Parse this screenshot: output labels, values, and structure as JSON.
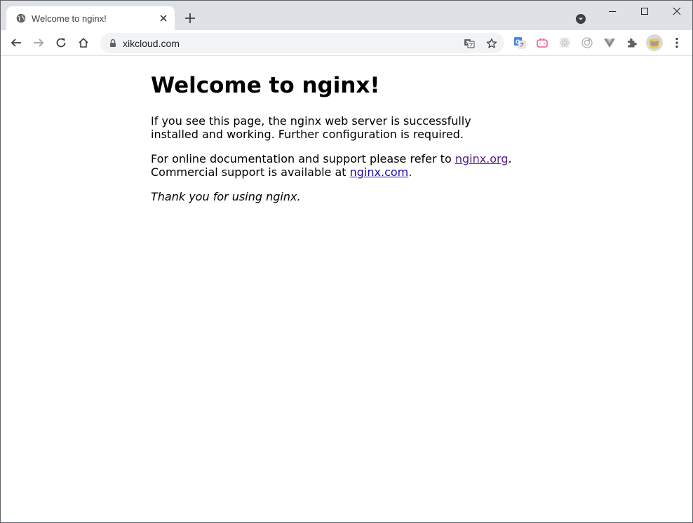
{
  "browser": {
    "tab": {
      "title": "Welcome to nginx!",
      "favicon": "globe-icon"
    },
    "address_bar": {
      "url": "xikcloud.com",
      "security_icon": "lock-icon"
    },
    "toolbar_icons": [
      "back-arrow-icon",
      "forward-arrow-icon",
      "reload-icon",
      "home-icon",
      "translate-icon",
      "star-icon",
      "puzzle-extensions-icon",
      "kebab-menu-icon"
    ],
    "extension_icons": [
      "google-translate-icon",
      "bilibili-tv-icon",
      "react-devtools-icon",
      "circle-target-icon",
      "vue-devtools-icon"
    ],
    "colors": {
      "tabstrip_bg": "#dee1e6",
      "omnibox_bg": "#f1f3f4",
      "link": "#1a0dab",
      "visited_link": "#551a8b"
    }
  },
  "page": {
    "heading": "Welcome to nginx!",
    "para1": "If you see this page, the nginx web server is successfully installed and working. Further configuration is required.",
    "para2_prefix": "For online documentation and support please refer to ",
    "para2_link": "nginx.org",
    "para2_mid": ".",
    "para2_line2_prefix": "Commercial support is available at ",
    "para2_line2_link": "nginx.com",
    "para2_line2_suffix": ".",
    "para3": "Thank you for using nginx."
  }
}
